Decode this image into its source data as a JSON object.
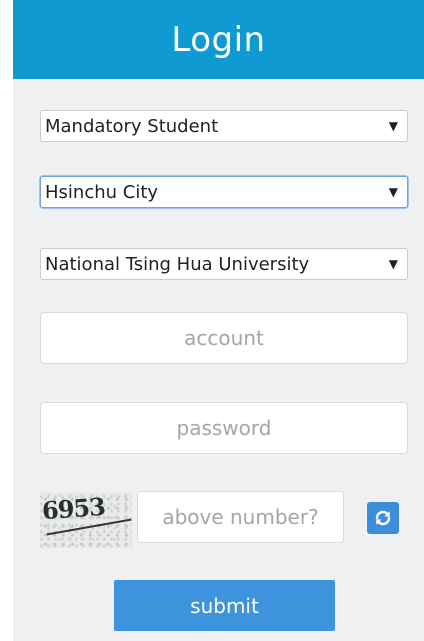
{
  "header": {
    "title": "Login"
  },
  "selects": {
    "identity": "Mandatory Student",
    "city": "Hsinchu City",
    "school": "National Tsing Hua University"
  },
  "inputs": {
    "account_placeholder": "account",
    "password_placeholder": "password",
    "captcha_placeholder": "above number?"
  },
  "captcha": {
    "digits": "6953"
  },
  "icons": {
    "refresh": "refresh-icon",
    "dropdown": "chevron-down-icon"
  },
  "buttons": {
    "submit_label": "submit"
  },
  "colors": {
    "header_bg": "#109ad2",
    "panel_bg": "#eef0f1",
    "button_bg": "#3d93dc"
  }
}
